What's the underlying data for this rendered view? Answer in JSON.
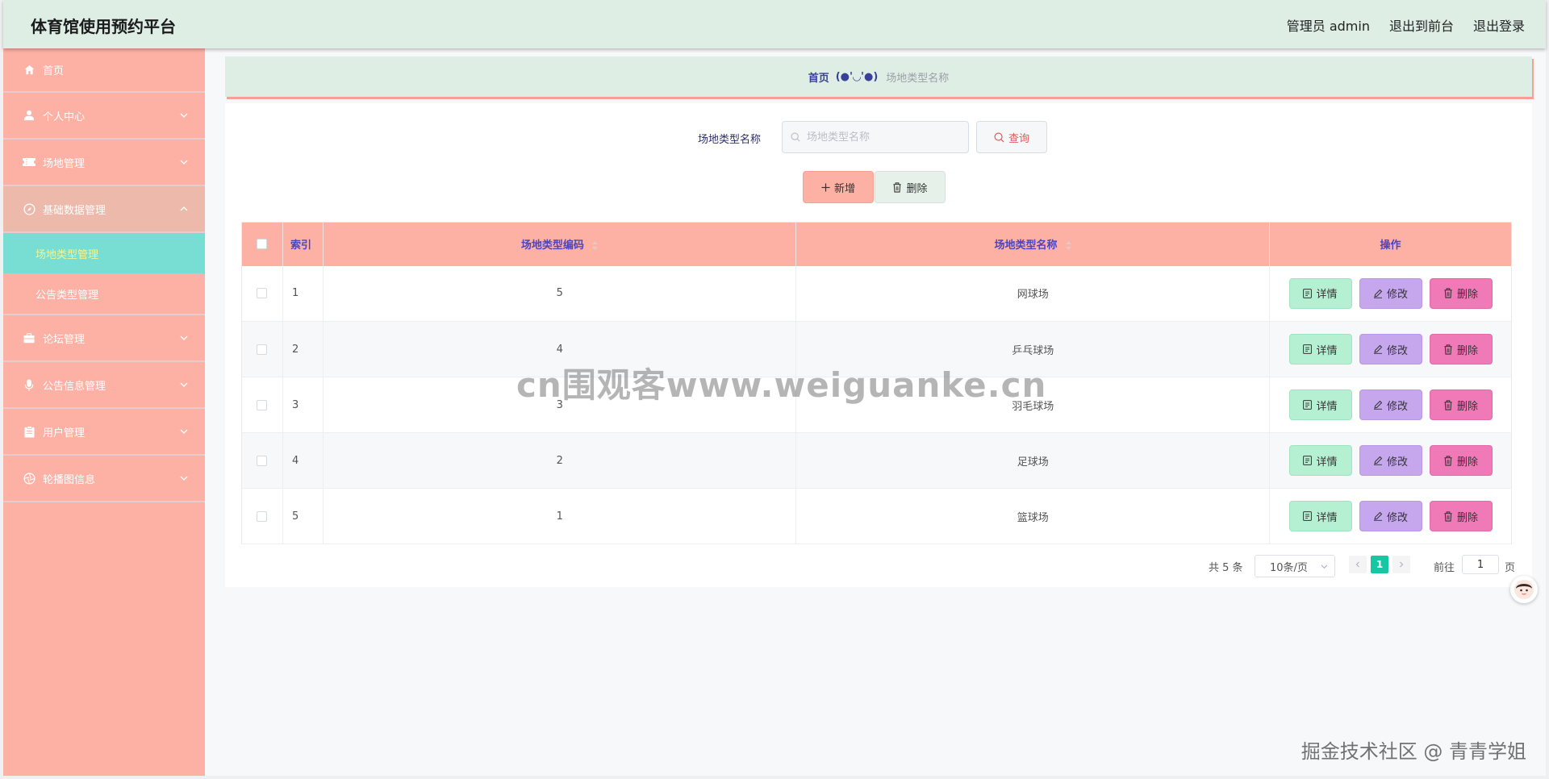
{
  "header": {
    "title": "体育馆使用预约平台",
    "user_label": "管理员 admin",
    "front_link": "退出到前台",
    "logout_link": "退出登录"
  },
  "sidebar": {
    "items": [
      {
        "label": "首页",
        "icon": "home-icon"
      },
      {
        "label": "个人中心",
        "icon": "user-icon"
      },
      {
        "label": "场地管理",
        "icon": "ticket-icon"
      },
      {
        "label": "基础数据管理",
        "icon": "compass-icon"
      },
      {
        "label": "论坛管理",
        "icon": "briefcase-icon"
      },
      {
        "label": "公告信息管理",
        "icon": "microphone-icon"
      },
      {
        "label": "用户管理",
        "icon": "clipboard-icon"
      },
      {
        "label": "轮播图信息",
        "icon": "aperture-icon"
      }
    ],
    "subitems": [
      {
        "label": "场地类型管理",
        "active": true
      },
      {
        "label": "公告类型管理",
        "active": false
      }
    ]
  },
  "breadcrumb": {
    "home": "首页",
    "separator": "(●'◡'●)",
    "current": "场地类型名称"
  },
  "search": {
    "label": "场地类型名称",
    "placeholder": "场地类型名称",
    "query_label": "查询"
  },
  "actions": {
    "add_label": "新增",
    "delete_label": "删除"
  },
  "table": {
    "headers": {
      "index": "索引",
      "code": "场地类型编码",
      "name": "场地类型名称",
      "ops": "操作"
    },
    "rows": [
      {
        "index": "1",
        "code": "5",
        "name": "网球场"
      },
      {
        "index": "2",
        "code": "4",
        "name": "乒乓球场"
      },
      {
        "index": "3",
        "code": "3",
        "name": "羽毛球场"
      },
      {
        "index": "4",
        "code": "2",
        "name": "足球场"
      },
      {
        "index": "5",
        "code": "1",
        "name": "篮球场"
      }
    ],
    "op_labels": {
      "detail": "详情",
      "edit": "修改",
      "delete": "删除"
    }
  },
  "pagination": {
    "total": "共 5 条",
    "page_size": "10条/页",
    "current_page": "1",
    "goto_label": "前往",
    "goto_value": "1",
    "page_suffix": "页"
  },
  "watermarks": {
    "center": "cn围观客www.weiguanke.cn",
    "bottom_right": "掘金技术社区 @ 青青学姐"
  },
  "colors": {
    "header_bg": "#deeee4",
    "sidebar_bg": "#fdb1a5",
    "active_sub_bg": "#78ded3",
    "table_header_bg": "#fdb1a5",
    "detail_btn": "#b6f0d2",
    "edit_btn": "#c6a7ee",
    "delete_btn": "#ef7ab7",
    "page_active": "#18c6a3"
  }
}
